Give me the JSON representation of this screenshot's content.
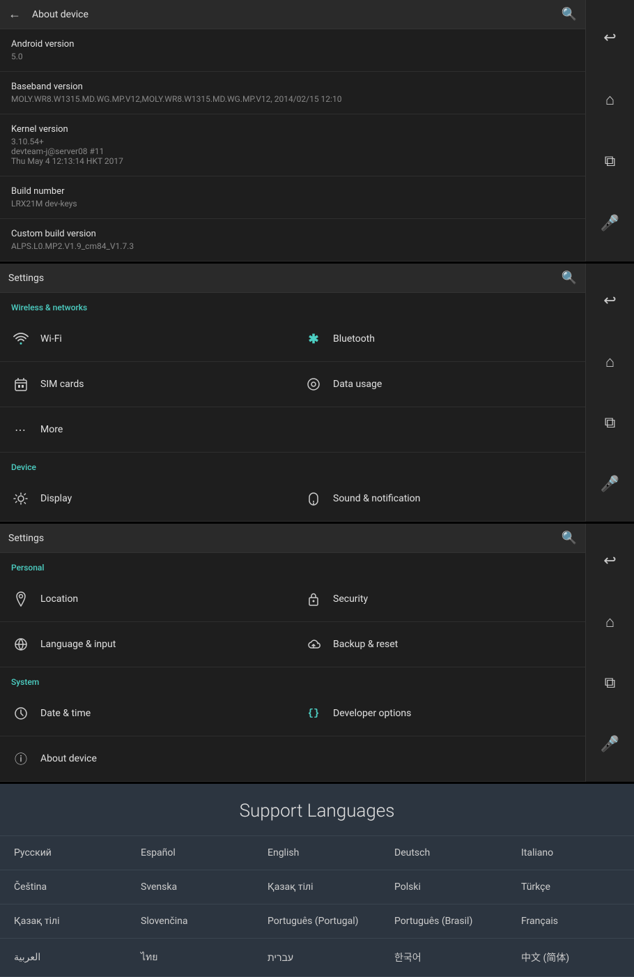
{
  "panel1": {
    "topbar": {
      "title": "About device",
      "back": "←",
      "search": "🔍"
    },
    "rows": [
      {
        "label": "Android version",
        "value": "5.0"
      },
      {
        "label": "Baseband version",
        "value": "MOLY.WR8.W1315.MD.WG.MP.V12,MOLY.WR8.W1315.MD.WG.MP.V12, 2014/02/15 12:10"
      },
      {
        "label": "Kernel version",
        "value": "3.10.54+\ndevteam-j@server08 #11\nThu May 4 12:13:14 HKT 2017"
      },
      {
        "label": "Build number",
        "value": "LRX21M dev-keys"
      },
      {
        "label": "Custom build version",
        "value": "ALPS.L0.MP2.V1.9_cm84_V1.7.3"
      }
    ],
    "sidebar": {
      "icons": [
        "↩",
        "⌂",
        "⧉",
        "🎤"
      ]
    }
  },
  "panel2": {
    "topbar": {
      "title": "Settings",
      "search": "🔍"
    },
    "section_wireless": "Wireless & networks",
    "section_device": "Device",
    "items": [
      {
        "id": "wifi",
        "label": "Wi-Fi",
        "icon": "wifi",
        "col": 1
      },
      {
        "id": "bluetooth",
        "label": "Bluetooth",
        "icon": "bt",
        "col": 2
      },
      {
        "id": "simcards",
        "label": "SIM cards",
        "icon": "sim",
        "col": 1
      },
      {
        "id": "datausage",
        "label": "Data usage",
        "icon": "data",
        "col": 2
      },
      {
        "id": "more",
        "label": "More",
        "icon": "more",
        "col": "full"
      },
      {
        "id": "display",
        "label": "Display",
        "icon": "display",
        "col": 1
      },
      {
        "id": "sound",
        "label": "Sound & notification",
        "icon": "sound",
        "col": 2
      }
    ],
    "sidebar": {
      "icons": [
        "↩",
        "⌂",
        "⧉",
        "🎤"
      ]
    }
  },
  "panel3": {
    "topbar": {
      "title": "Settings",
      "search": "🔍"
    },
    "section_personal": "Personal",
    "section_system": "System",
    "items": [
      {
        "id": "location",
        "label": "Location",
        "icon": "location",
        "col": 1
      },
      {
        "id": "security",
        "label": "Security",
        "icon": "security",
        "col": 2
      },
      {
        "id": "language",
        "label": "Language & input",
        "icon": "language",
        "col": 1
      },
      {
        "id": "backup",
        "label": "Backup & reset",
        "icon": "backup",
        "col": 2
      },
      {
        "id": "datetime",
        "label": "Date & time",
        "icon": "datetime",
        "col": 1
      },
      {
        "id": "developer",
        "label": "Developer options",
        "icon": "developer",
        "col": 2
      },
      {
        "id": "about",
        "label": "About device",
        "icon": "about",
        "col": "full"
      }
    ],
    "sidebar": {
      "icons": [
        "↩",
        "⌂",
        "⧉",
        "🎤"
      ]
    }
  },
  "support_languages": {
    "title": "Support Languages",
    "rows": [
      [
        "Русский",
        "Español",
        "English",
        "Deutsch",
        "Italiano"
      ],
      [
        "Čeština",
        "Svenska",
        "Қазақ тілі",
        "Polski",
        "Türkçe"
      ],
      [
        "Қазақ тілі",
        "Slovenčina",
        "Português (Portugal)",
        "Português (Brasil)",
        "Français"
      ],
      [
        "العربية",
        "ไทย",
        "עברית",
        "한국어",
        "中文 (简体)"
      ]
    ]
  }
}
